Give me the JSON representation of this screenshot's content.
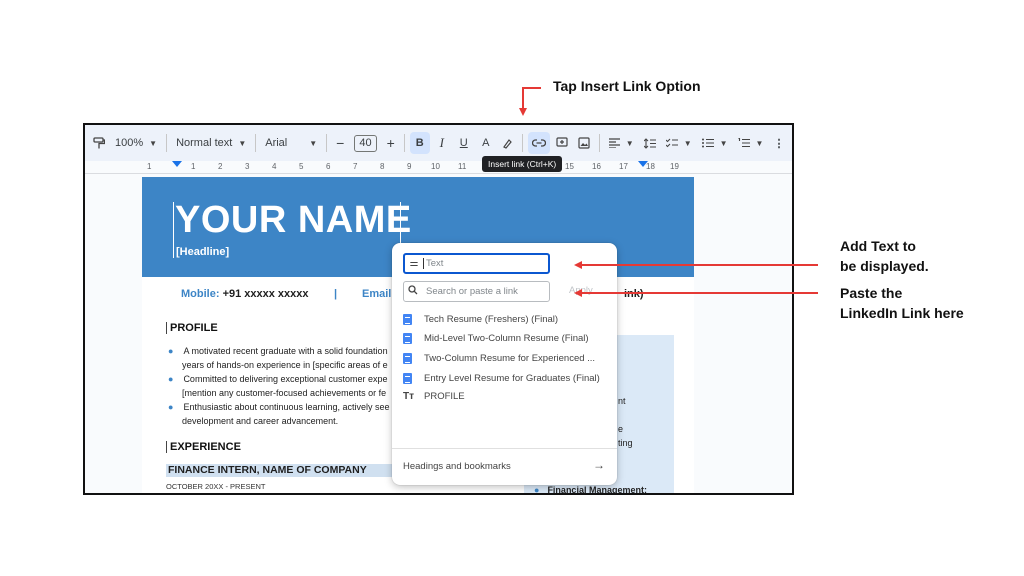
{
  "annotations": {
    "top": "Tap Insert Link Option",
    "text_line1": "Add Text to",
    "text_line2": "be displayed.",
    "link_line1": "Paste the",
    "link_line2": "LinkedIn Link here",
    "arrow_color": "#e53935"
  },
  "toolbar": {
    "zoom": "100%",
    "style": "Normal text",
    "font": "Arial",
    "font_size": "40",
    "minus": "−",
    "plus": "+",
    "bold": "B",
    "italic": "I",
    "underline": "U",
    "text_color": "A",
    "tooltip": "Insert link (Ctrl+K)"
  },
  "ruler": [
    "1",
    "1",
    "2",
    "3",
    "4",
    "5",
    "6",
    "7",
    "8",
    "9",
    "10",
    "11",
    "15",
    "16",
    "17",
    "18",
    "19"
  ],
  "document": {
    "name": "YOUR NAME",
    "headline": "[Headline]",
    "mobile_label": "Mobile:",
    "mobile_value": "+91 xxxxx xxxxx",
    "divider": "|",
    "email_label": "Email",
    "link_fragment": "ink)",
    "profile_heading": "PROFILE",
    "profile_lines": [
      "A motivated recent graduate with a solid foundation",
      "years of hands-on experience in [specific areas of e",
      "Committed to delivering exceptional customer expe",
      "[mention any customer-focused achievements or fe",
      "Enthusiastic about continuous learning, actively see",
      "development and career advancement."
    ],
    "experience_heading": "EXPERIENCE",
    "job_title": "FINANCE INTERN, NAME OF COMPANY",
    "job_dates": "OCTOBER 20XX - PRESENT",
    "sidebar_fragments": [
      "nt",
      "e",
      "ting"
    ],
    "sidebar_bold": "Financial Management:",
    "banner_color": "#3d85c6"
  },
  "link_dialog": {
    "text_placeholder": "Text",
    "link_placeholder": "Search or paste a link",
    "apply_label": "Apply",
    "suggestions": [
      "Tech Resume (Freshers) (Final)",
      "Mid-Level Two-Column Resume (Final)",
      "Two-Column Resume for Experienced ...",
      "Entry Level Resume for Graduates (Final)"
    ],
    "heading_suggestion": "PROFILE",
    "footer_label": "Headings and bookmarks"
  }
}
